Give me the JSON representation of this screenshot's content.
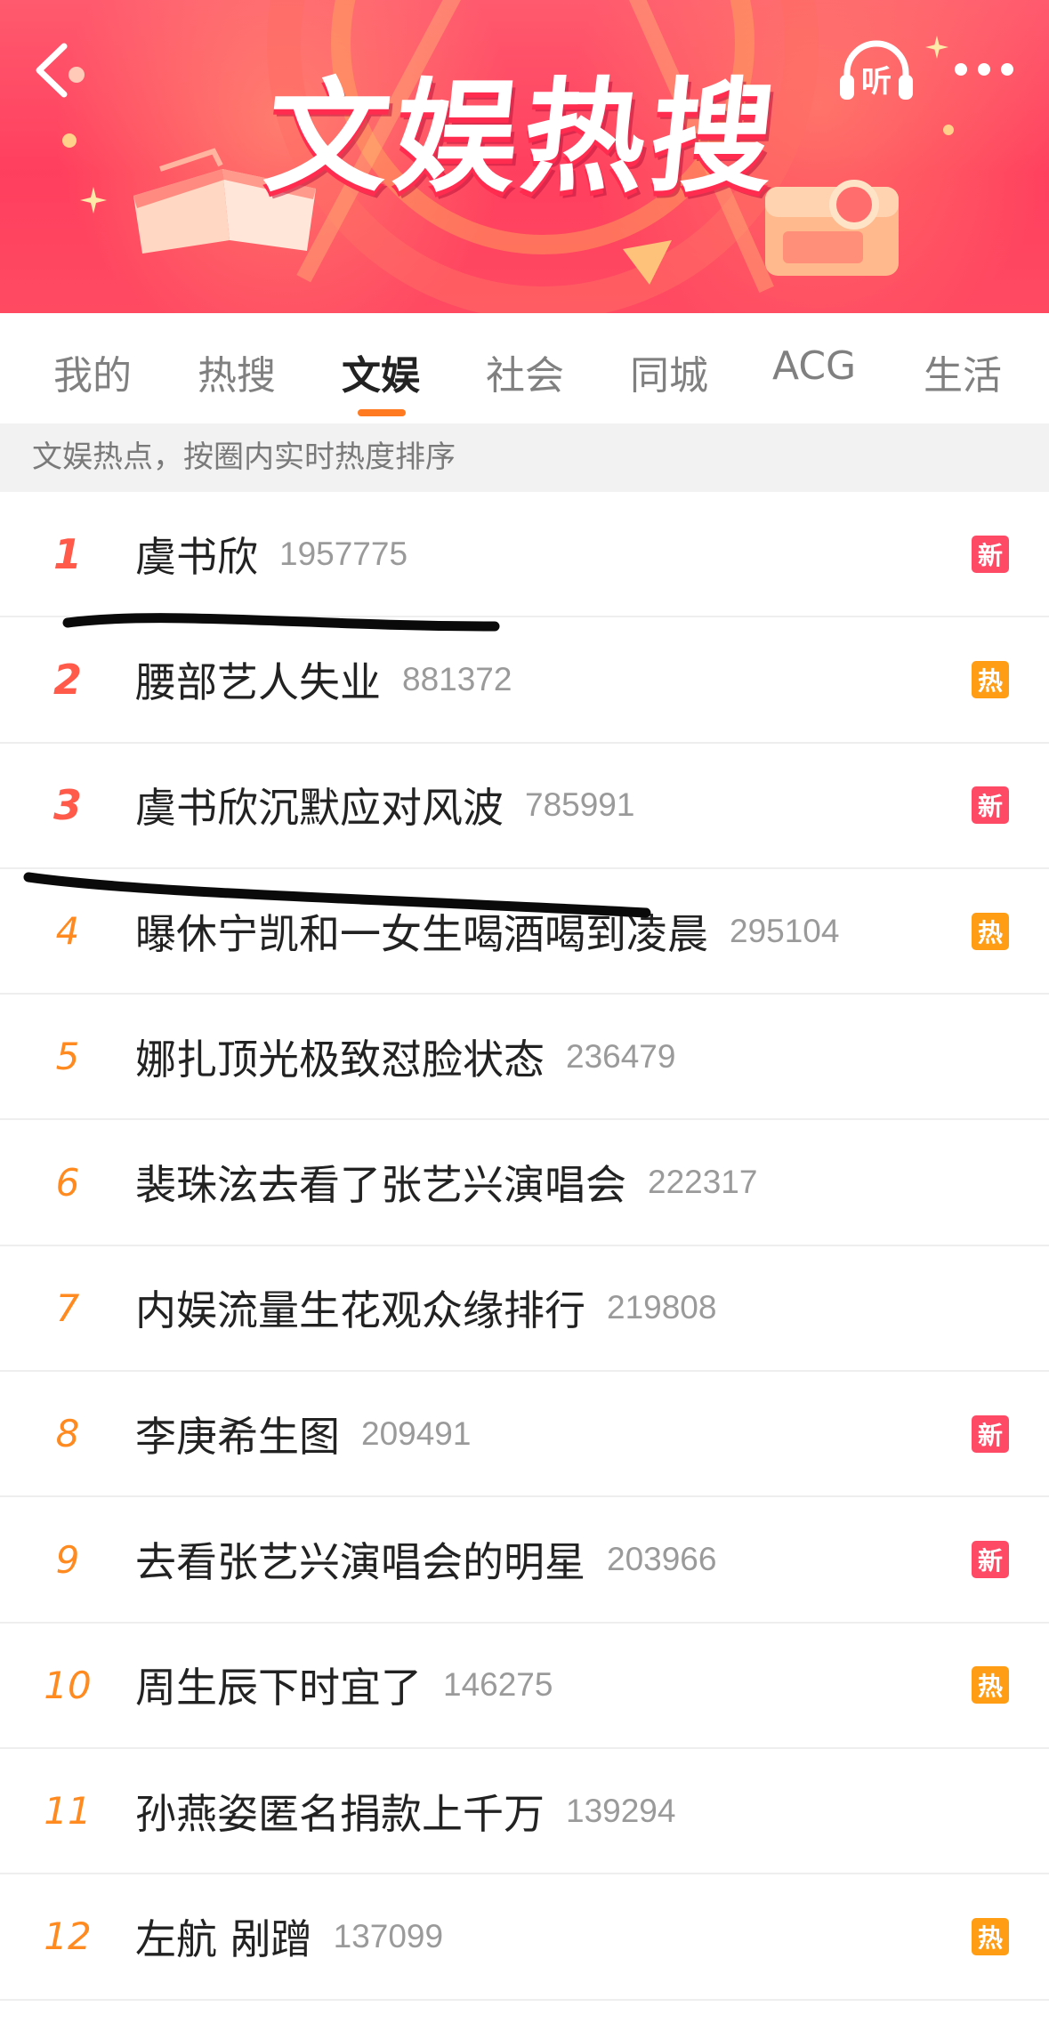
{
  "header": {
    "title": "文娱热搜",
    "listen_label": "听"
  },
  "tabs": [
    {
      "label": "我的"
    },
    {
      "label": "热搜"
    },
    {
      "label": "文娱"
    },
    {
      "label": "社会"
    },
    {
      "label": "同城"
    },
    {
      "label": "ACG"
    },
    {
      "label": "生活"
    }
  ],
  "active_tab": "文娱",
  "subheader": "文娱热点，按圈内实时热度排序",
  "items": [
    {
      "rank": "1",
      "title": "虞书欣",
      "count": "1957775",
      "badge": "新"
    },
    {
      "rank": "2",
      "title": "腰部艺人失业",
      "count": "881372",
      "badge": "热"
    },
    {
      "rank": "3",
      "title": "虞书欣沉默应对风波",
      "count": "785991",
      "badge": "新"
    },
    {
      "rank": "4",
      "title": "曝休宁凯和一女生喝酒喝到凌晨",
      "count": "295104",
      "badge": "热"
    },
    {
      "rank": "5",
      "title": "娜扎顶光极致怼脸状态",
      "count": "236479",
      "badge": ""
    },
    {
      "rank": "6",
      "title": "裴珠泫去看了张艺兴演唱会",
      "count": "222317",
      "badge": ""
    },
    {
      "rank": "7",
      "title": "内娱流量生花观众缘排行",
      "count": "219808",
      "badge": ""
    },
    {
      "rank": "8",
      "title": "李庚希生图",
      "count": "209491",
      "badge": "新"
    },
    {
      "rank": "9",
      "title": "去看张艺兴演唱会的明星",
      "count": "203966",
      "badge": "新"
    },
    {
      "rank": "10",
      "title": "周生辰下时宜了",
      "count": "146275",
      "badge": "热"
    },
    {
      "rank": "11",
      "title": "孙燕姿匿名捐款上千万",
      "count": "139294",
      "badge": ""
    },
    {
      "rank": "12",
      "title": "左航 剐蹭",
      "count": "137099",
      "badge": "热"
    }
  ],
  "colors": {
    "banner": "#ff4a62",
    "accent": "#ff7a20",
    "rank_top": "#ff5a4a",
    "rank": "#ff8a1f",
    "badge_new": "#ff4a66",
    "badge_hot": "#ff9d14"
  }
}
